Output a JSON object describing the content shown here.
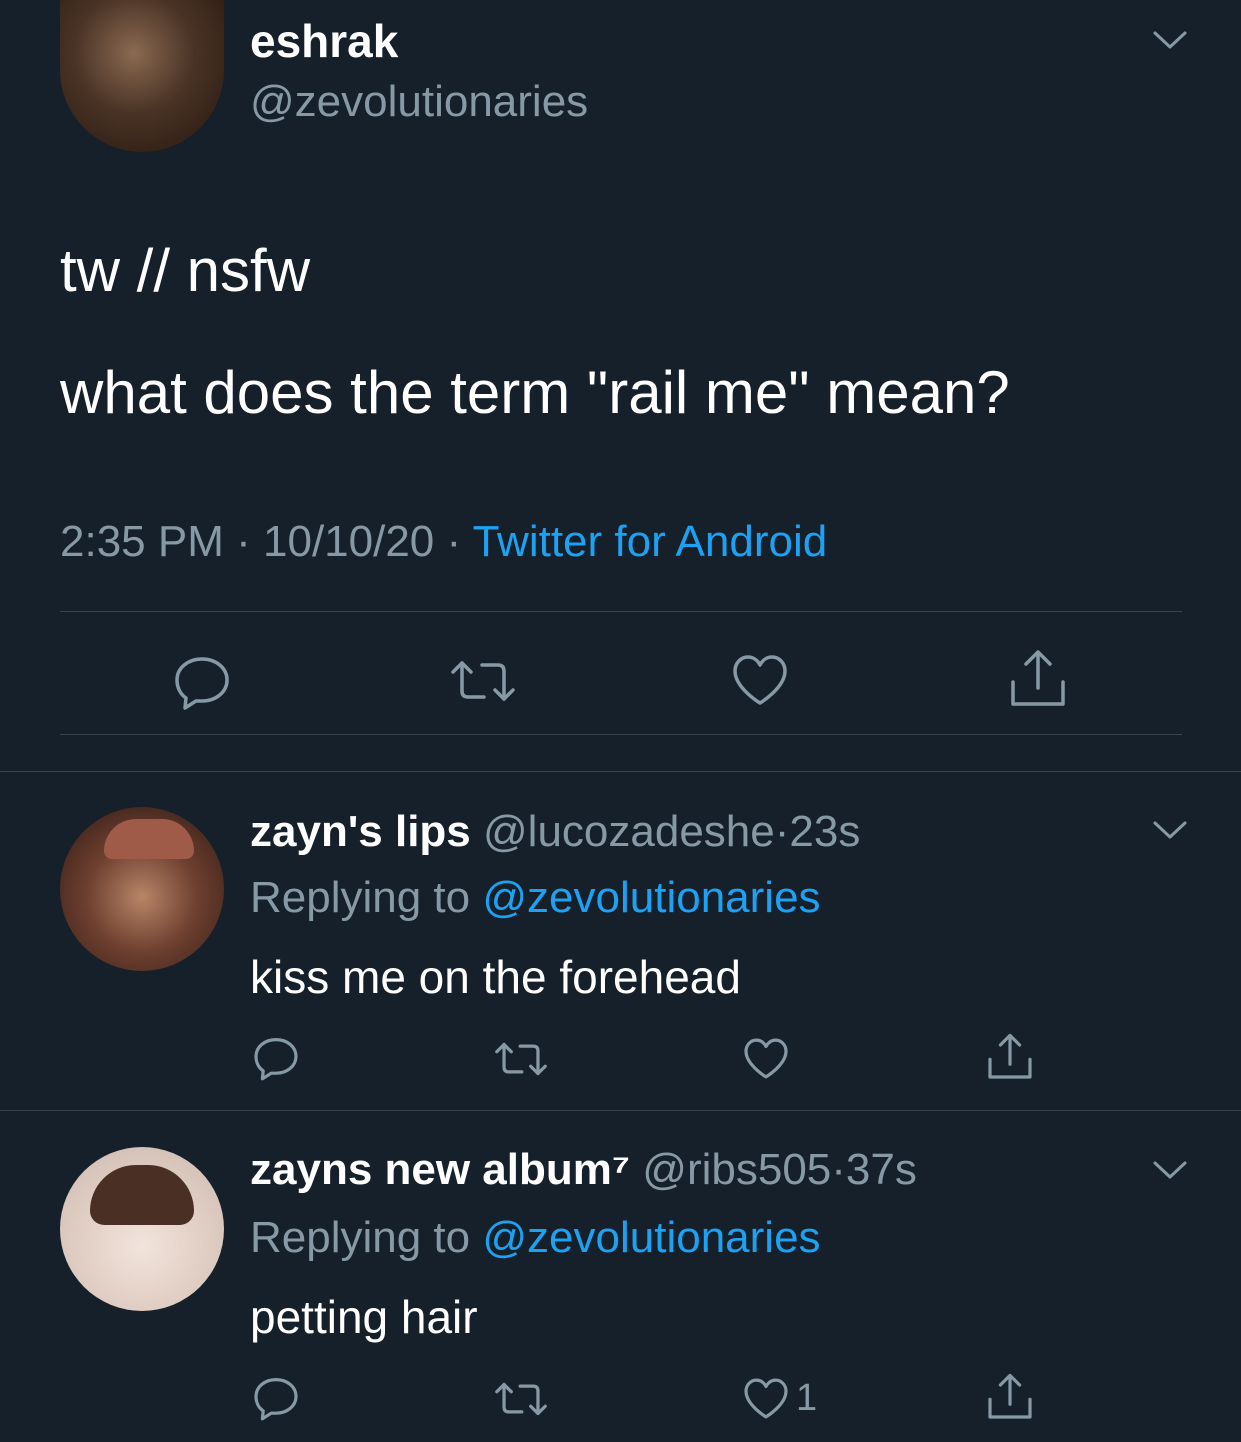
{
  "main_tweet": {
    "display_name": "eshrak",
    "handle": "@zevolutionaries",
    "lines": [
      "tw // nsfw",
      "what does the term \"rail me\" mean?"
    ],
    "time": "2:35 PM",
    "date": "10/10/20",
    "source": "Twitter for Android",
    "sep": "·"
  },
  "replies": [
    {
      "display_name": "zayn's lips",
      "handle": "@lucozadeshe",
      "sep": "·",
      "time_ago": "23s",
      "replying_prefix": "Replying to",
      "replying_to": "@zevolutionaries",
      "text": "kiss me on the forehead",
      "like_count": ""
    },
    {
      "display_name": "zayns new album⁷",
      "handle": "@ribs505",
      "sep": "·",
      "time_ago": "37s",
      "replying_prefix": "Replying to",
      "replying_to": "@zevolutionaries",
      "text": "petting hair",
      "like_count": "1"
    }
  ],
  "icons": [
    "chevron-down-icon",
    "reply-icon",
    "retweet-icon",
    "like-icon",
    "share-icon"
  ],
  "colors": {
    "background": "#15202b",
    "text": "#ffffff",
    "muted": "#8899a6",
    "link": "#1da1f2",
    "divider": "#38444d"
  }
}
